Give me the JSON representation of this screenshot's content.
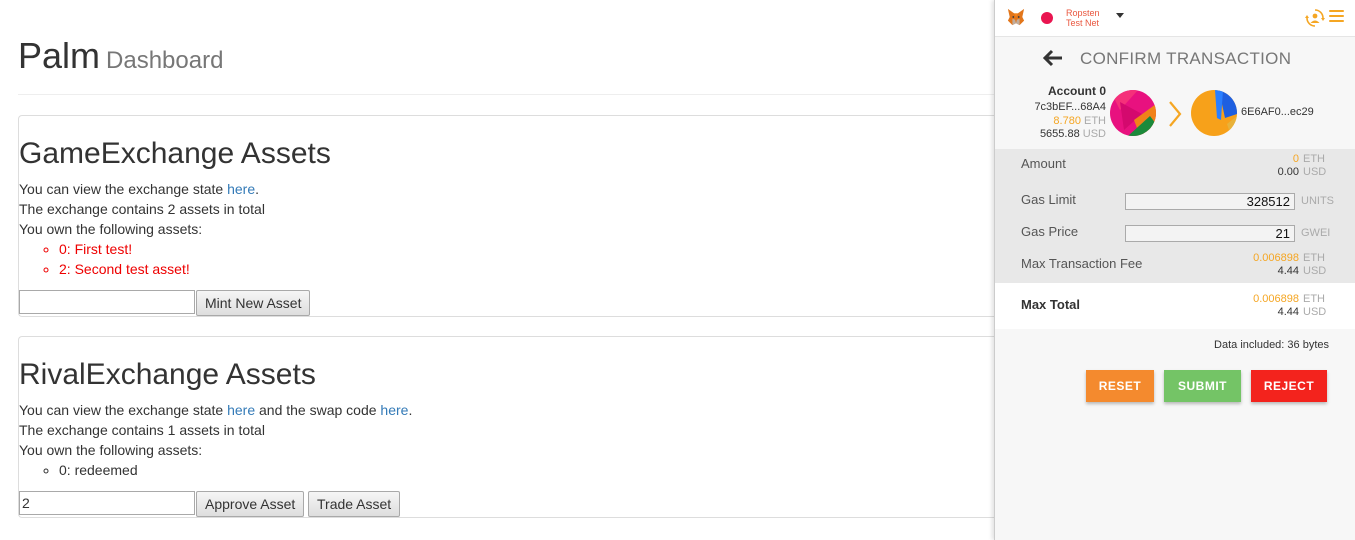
{
  "dapp": {
    "title": "Palm",
    "subtitle": "Dashboard",
    "game": {
      "heading": "GameExchange Assets",
      "view_text": "You can view the exchange state ",
      "view_link": "here",
      "view_end": ".",
      "count_text": "The exchange contains 2 assets in total",
      "own_text": "You own the following assets:",
      "assets": [
        "0: First test!",
        "2: Second test asset!"
      ],
      "input_value": "",
      "mint_button": "Mint New Asset"
    },
    "rival": {
      "heading": "RivalExchange Assets",
      "view_text": "You can view the exchange state ",
      "view_link": "here",
      "middle_text": " and the swap code ",
      "swap_link": "here",
      "view_end": ".",
      "count_text": "The exchange contains 1 assets in total",
      "own_text": "You own the following assets:",
      "assets": [
        "0: redeemed"
      ],
      "input_value": "2",
      "approve_button": "Approve Asset",
      "trade_button": "Trade Asset"
    }
  },
  "metamask": {
    "network_line1": "Ropsten",
    "network_line2": "Test Net",
    "network_color": "#e91550",
    "accent_color": "#f5a623",
    "icons": [
      "metamask-fox-icon",
      "sync-icon",
      "menu-icon",
      "back-arrow-icon",
      "chevron-right-icon"
    ],
    "title": "CONFIRM TRANSACTION",
    "from": {
      "account_name": "Account 0",
      "address": "7c3bEF...68A4",
      "eth_balance": "8.780",
      "eth_unit": "ETH",
      "usd_balance": "5655.88",
      "usd_unit": "USD"
    },
    "to_address": "6E6AF0...ec29",
    "amount": {
      "label": "Amount",
      "eth": "0",
      "eth_unit": "ETH",
      "usd": "0.00",
      "usd_unit": "USD"
    },
    "gas_limit": {
      "label": "Gas Limit",
      "value": "328512",
      "unit": "UNITS"
    },
    "gas_price": {
      "label": "Gas Price",
      "value": "21",
      "unit": "GWEI"
    },
    "max_fee": {
      "label": "Max Transaction Fee",
      "eth": "0.006898",
      "eth_unit": "ETH",
      "usd": "4.44",
      "usd_unit": "USD"
    },
    "max_total": {
      "label": "Max Total",
      "eth": "0.006898",
      "eth_unit": "ETH",
      "usd": "4.44",
      "usd_unit": "USD"
    },
    "data_included": "Data included: 36 bytes",
    "buttons": {
      "reset": "RESET",
      "reset_color": "#f48a2e",
      "submit": "SUBMIT",
      "submit_color": "#74c466",
      "reject": "REJECT",
      "reject_color": "#f3231d"
    }
  }
}
